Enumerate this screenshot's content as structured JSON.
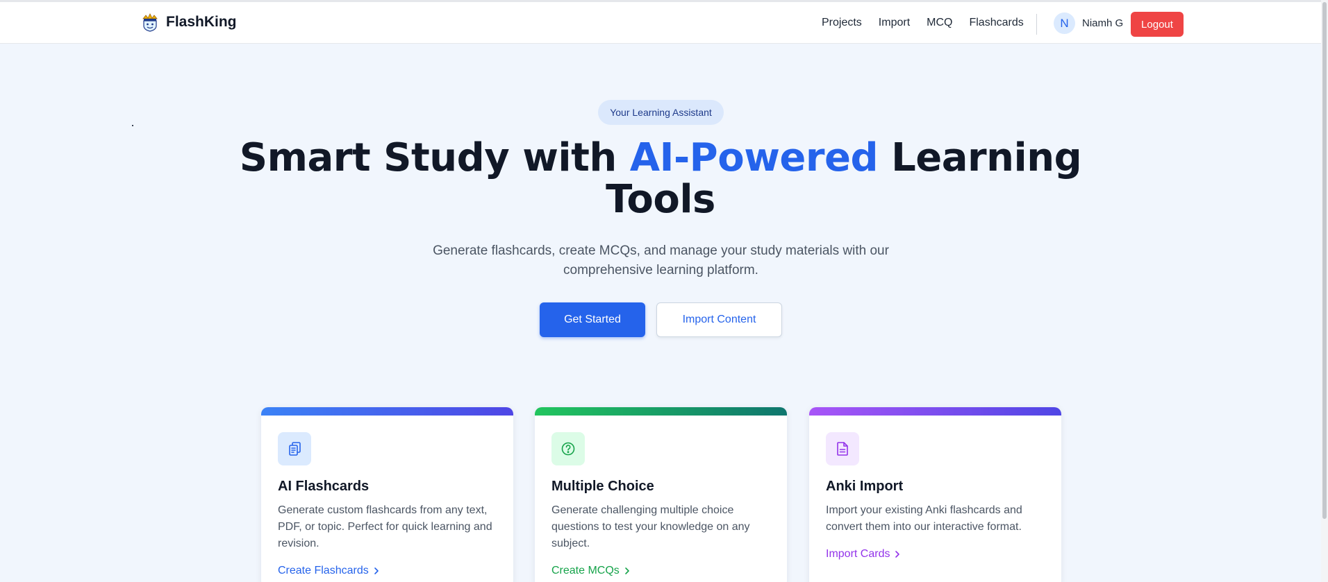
{
  "header": {
    "brand": "FlashKing",
    "nav": [
      "Projects",
      "Import",
      "MCQ",
      "Flashcards"
    ],
    "avatar_initial": "N",
    "user_name": "Niamh G",
    "logout_label": "Logout"
  },
  "hero": {
    "badge": "Your Learning Assistant",
    "title_part1": "Smart Study with ",
    "title_accent": "AI-Powered",
    "title_part2": " Learning Tools",
    "subtitle": "Generate flashcards, create MCQs, and manage your study materials with our comprehensive learning platform.",
    "primary_button": "Get Started",
    "secondary_button": "Import Content"
  },
  "features": [
    {
      "title": "AI Flashcards",
      "description": "Generate custom flashcards from any text, PDF, or topic. Perfect for quick learning and revision.",
      "link": "Create Flashcards",
      "icon": "flashcards-icon",
      "accent": "#2563eb"
    },
    {
      "title": "Multiple Choice",
      "description": "Generate challenging multiple choice questions to test your knowledge on any subject.",
      "link": "Create MCQs",
      "icon": "question-circle-icon",
      "accent": "#16a34a"
    },
    {
      "title": "Anki Import",
      "description": "Import your existing Anki flashcards and convert them into our interactive format.",
      "link": "Import Cards",
      "icon": "document-icon",
      "accent": "#9333ea"
    }
  ],
  "colors": {
    "primary": "#2563eb",
    "danger": "#ef4444",
    "background": "#f1f6fd"
  }
}
